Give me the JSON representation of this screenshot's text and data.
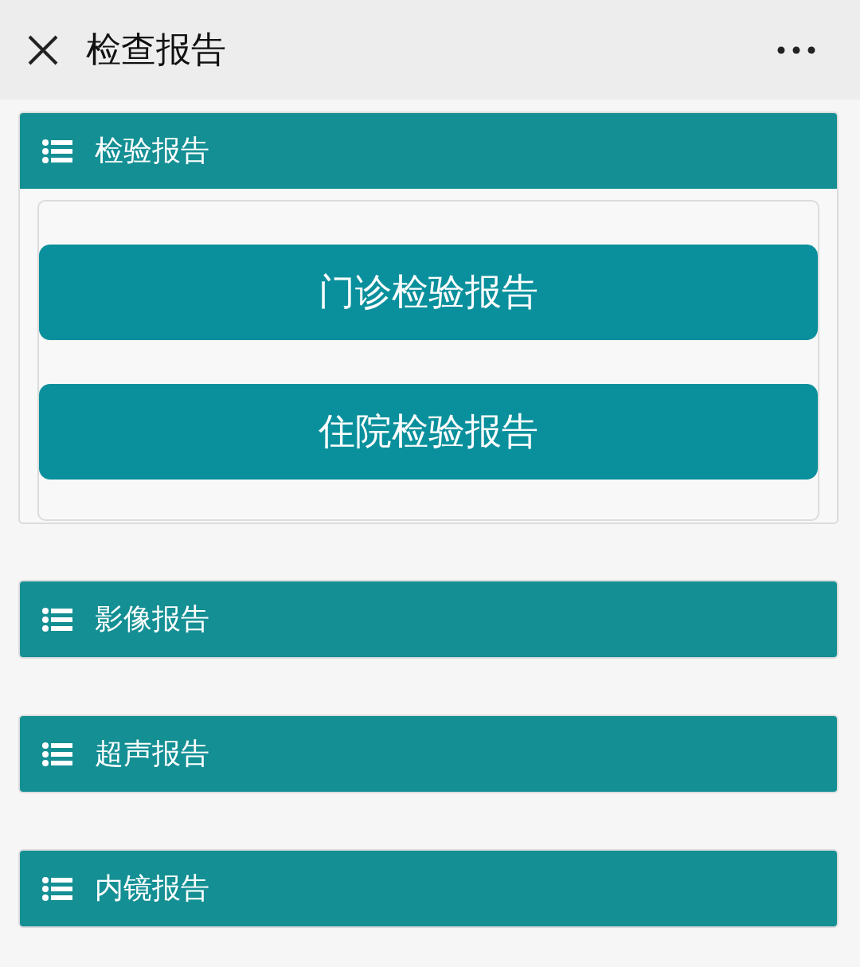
{
  "top_bar": {
    "title": "检查报告"
  },
  "sections": [
    {
      "label": "检验报告",
      "expanded": true,
      "buttons": [
        "门诊检验报告",
        "住院检验报告"
      ]
    },
    {
      "label": "影像报告",
      "expanded": false
    },
    {
      "label": "超声报告",
      "expanded": false
    },
    {
      "label": "内镜报告",
      "expanded": false
    }
  ]
}
